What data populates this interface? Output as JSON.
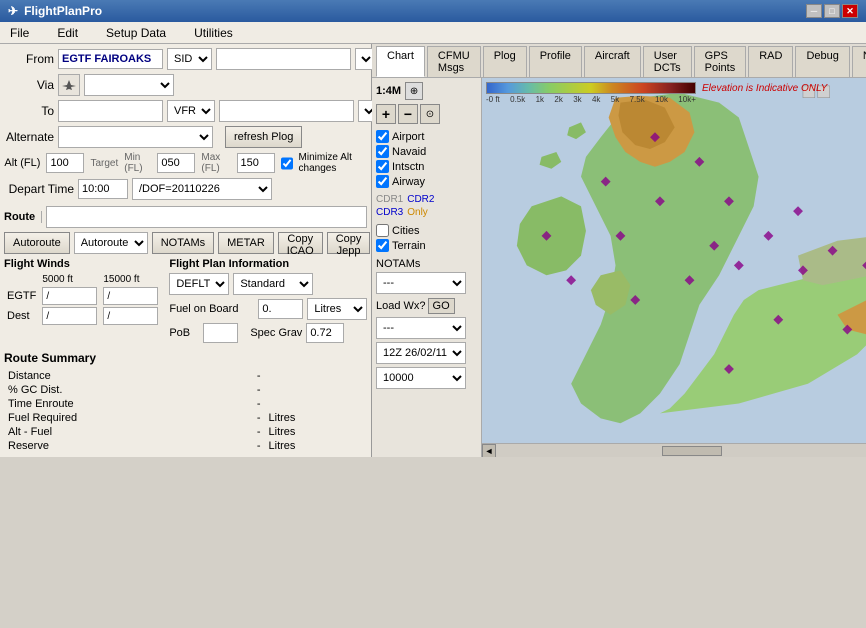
{
  "titlebar": {
    "title": "FlightPlanPro",
    "minimize": "─",
    "maximize": "□",
    "close": "✕"
  },
  "menubar": {
    "items": [
      "File",
      "Edit",
      "Setup Data",
      "Utilities"
    ]
  },
  "form": {
    "from_label": "From",
    "from_value": "EGTF FAIROAKS",
    "sid_label": "SID",
    "via_label": "Via",
    "to_label": "To",
    "vfr_label": "VFR",
    "alternate_label": "Alternate",
    "refresh_plog": "refresh Plog",
    "target_label": "Target",
    "min_fl_label": "Min (FL)",
    "max_fl_label": "Max (FL)",
    "alt_fl_label": "Alt (FL)",
    "alt_value": "100",
    "min_value": "050",
    "max_value": "150",
    "minimize_alt": "Minimize Alt changes",
    "depart_label": "Depart Time",
    "depart_time": "10:00",
    "dof_value": "/DOF=20110226"
  },
  "route": {
    "label": "Route",
    "autoroute_btn": "Autoroute",
    "autoroute_select": "Autoroute",
    "notams_btn": "NOTAMs",
    "metar_btn": "METAR",
    "copyicao_btn": "Copy ICAO",
    "copyjepp_btn": "Copy Jepp"
  },
  "winds": {
    "title": "Flight Winds",
    "col1": "5000 ft",
    "col2": "15000 ft",
    "rows": [
      {
        "label": "EGTF",
        "v1": "/",
        "v2": "/"
      },
      {
        "label": "Dest",
        "v1": "/",
        "v2": "/"
      }
    ]
  },
  "fp_info": {
    "title": "Flight Plan Information",
    "fuel_type_value": "DEFLT",
    "fuel_standard": "Standard",
    "fuel_on_board_label": "Fuel on Board",
    "fuel_value": "0.",
    "fuel_unit": "Litres",
    "pob_label": "PoB",
    "pob_value": "",
    "spec_grav_label": "Spec Grav",
    "spec_grav_value": "0.72"
  },
  "route_summary": {
    "title": "Route Summary",
    "items": [
      {
        "label": "Distance",
        "value": "-",
        "unit": ""
      },
      {
        "label": "% GC Dist.",
        "value": "-",
        "unit": ""
      },
      {
        "label": "Time Enroute",
        "value": "-",
        "unit": ""
      },
      {
        "label": "Fuel Required",
        "value": "-",
        "unit": "Litres"
      },
      {
        "label": "Alt - Fuel",
        "value": "-",
        "unit": "Litres"
      },
      {
        "label": "Reserve",
        "value": "-",
        "unit": "Litres"
      }
    ]
  },
  "tabs": {
    "items": [
      "Chart",
      "CFMU Msgs",
      "Plog",
      "Profile",
      "Aircraft",
      "User DCTs",
      "GPS Points",
      "RAD",
      "Debug",
      "NOTAM"
    ]
  },
  "map": {
    "scale": "1:4M",
    "elevation_note": "Elevation is Indicative ONLY",
    "elev_labels": [
      "-0 ft",
      "0.5k",
      "1k",
      "2k",
      "3k",
      "4k",
      "5k",
      "7.5k",
      "10k",
      "10k+"
    ],
    "checkboxes": [
      {
        "label": "Airport",
        "checked": true
      },
      {
        "label": "Navaid",
        "checked": true
      },
      {
        "label": "Intsctn",
        "checked": true
      },
      {
        "label": "Airway",
        "checked": true
      }
    ],
    "cdr": [
      {
        "label": "CDR1",
        "active": false
      },
      {
        "label": "CDR2",
        "active": true
      },
      {
        "label": "CDR3",
        "active": true
      },
      {
        "label": "Only",
        "active": true,
        "color": "orange"
      }
    ],
    "cities_checked": false,
    "terrain_checked": true,
    "notams_label": "NOTAMs",
    "notams_select": "---",
    "load_wx": "Load Wx?",
    "go_btn": "GO",
    "wx_select": "---",
    "time_select": "12Z 26/02/11",
    "alt_select": "10000"
  }
}
